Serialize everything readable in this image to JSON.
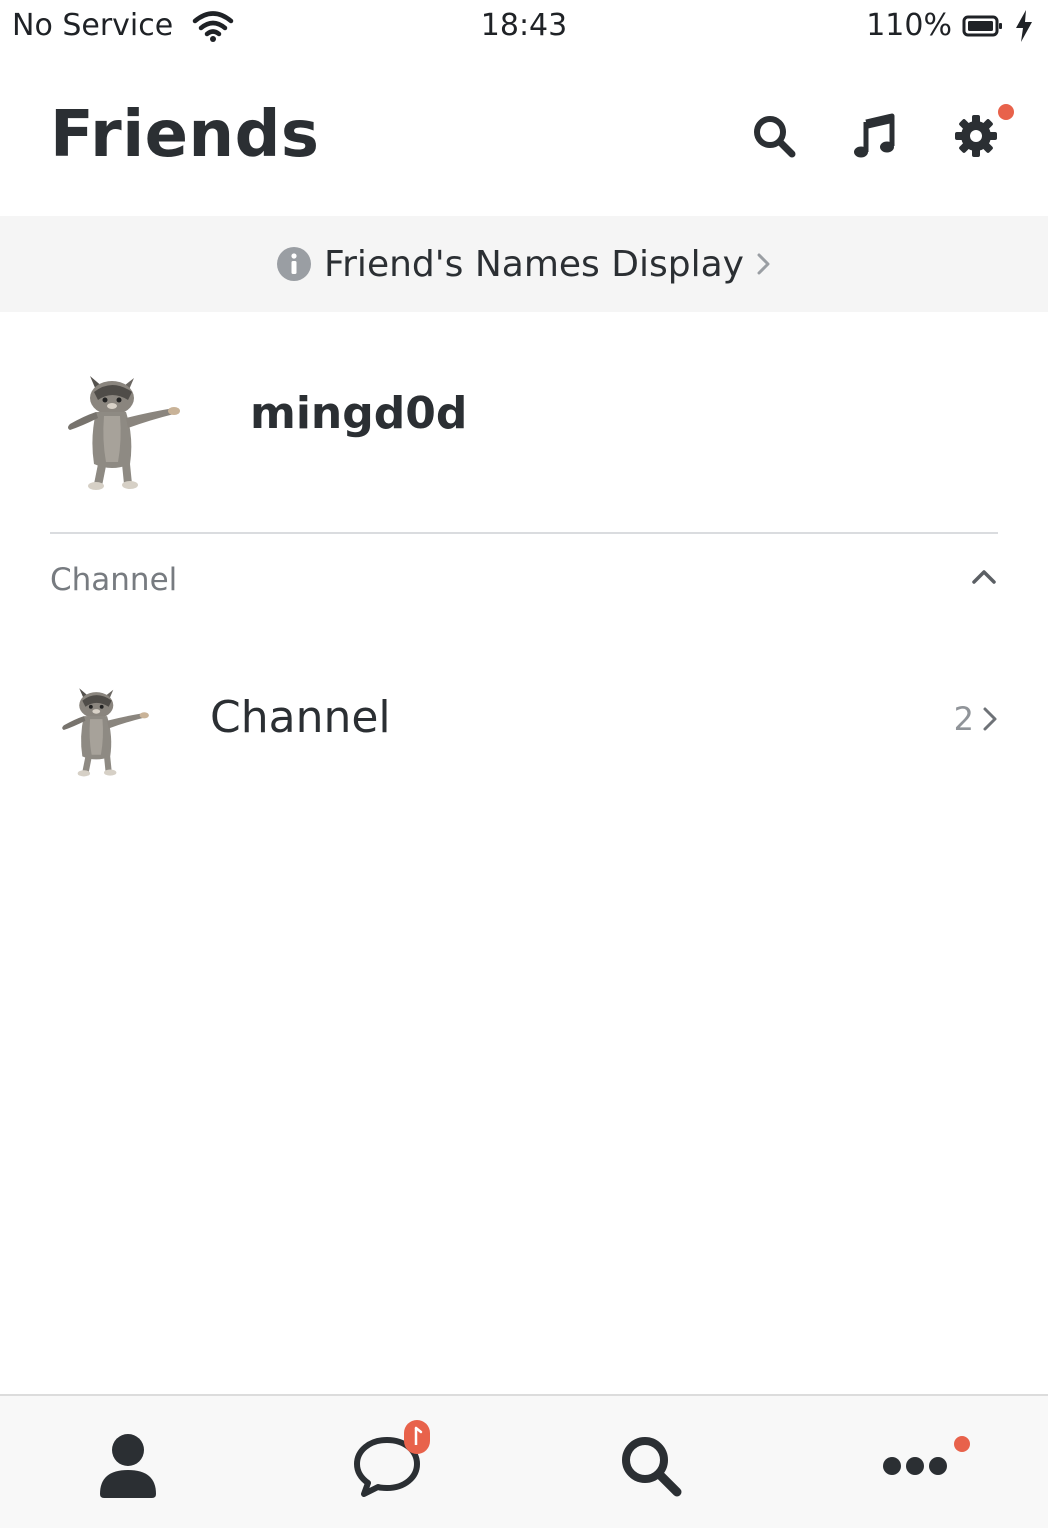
{
  "status_bar": {
    "carrier": "No Service",
    "time": "18:43",
    "battery": "110%"
  },
  "header": {
    "title": "Friends"
  },
  "banner": {
    "text": "Friend's Names Display"
  },
  "profile": {
    "name": "mingd0d"
  },
  "section": {
    "title": "Channel",
    "rows": [
      {
        "name": "Channel",
        "count": "2"
      }
    ]
  },
  "tabbar": {
    "tabs": [
      "friends-icon",
      "chats-icon",
      "search-icon",
      "more-icon"
    ]
  },
  "colors": {
    "badge": "#e8624b",
    "text_dark": "#2b2f33",
    "text_muted": "#777b80"
  }
}
